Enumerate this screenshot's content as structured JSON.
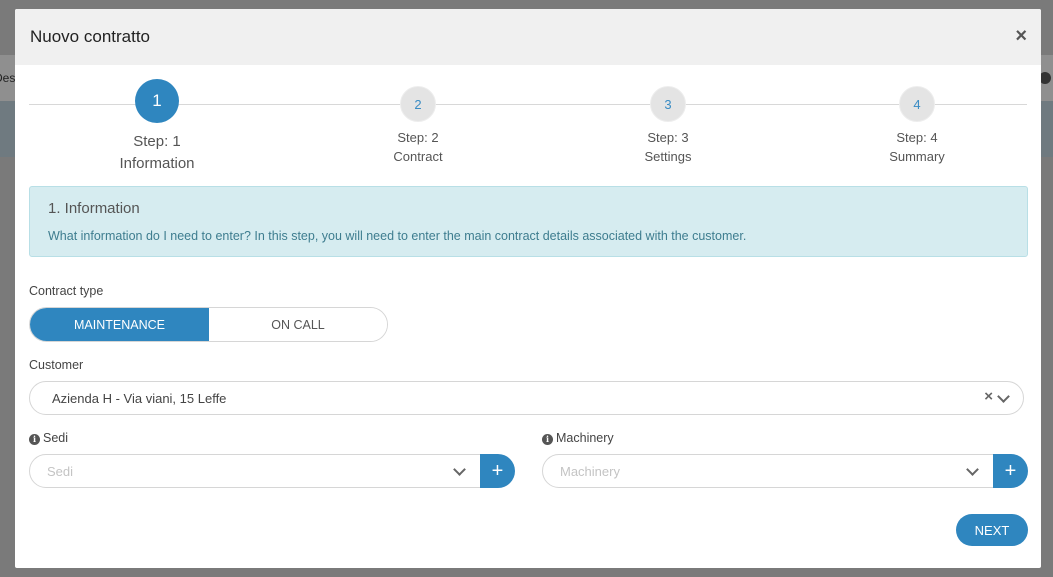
{
  "background": {
    "left_text": "Des"
  },
  "modal": {
    "title": "Nuovo contratto",
    "close_label": "×"
  },
  "steps": [
    {
      "number": "1",
      "line1": "Step: 1",
      "line2": "Information",
      "active": true
    },
    {
      "number": "2",
      "line1": "Step: 2",
      "line2": "Contract",
      "active": false
    },
    {
      "number": "3",
      "line1": "Step: 3",
      "line2": "Settings",
      "active": false
    },
    {
      "number": "4",
      "line1": "Step: 4",
      "line2": "Summary",
      "active": false
    }
  ],
  "info": {
    "title": "1. Information",
    "text": "What information do I need to enter? In this step, you will need to enter the main contract details associated with the customer."
  },
  "form": {
    "contract_type_label": "Contract type",
    "contract_type_options": [
      "MAINTENANCE",
      "ON CALL"
    ],
    "contract_type_selected": "MAINTENANCE",
    "customer_label": "Customer",
    "customer_value": "Azienda H - Via viani, 15 Leffe",
    "sedi_label": "Sedi",
    "sedi_placeholder": "Sedi",
    "machinery_label": "Machinery",
    "machinery_placeholder": "Machinery",
    "add_label": "+"
  },
  "actions": {
    "next_label": "NEXT"
  },
  "colors": {
    "primary": "#2f86bf",
    "info_bg": "#d6ecf0",
    "header_bg": "#f0f0f0"
  }
}
